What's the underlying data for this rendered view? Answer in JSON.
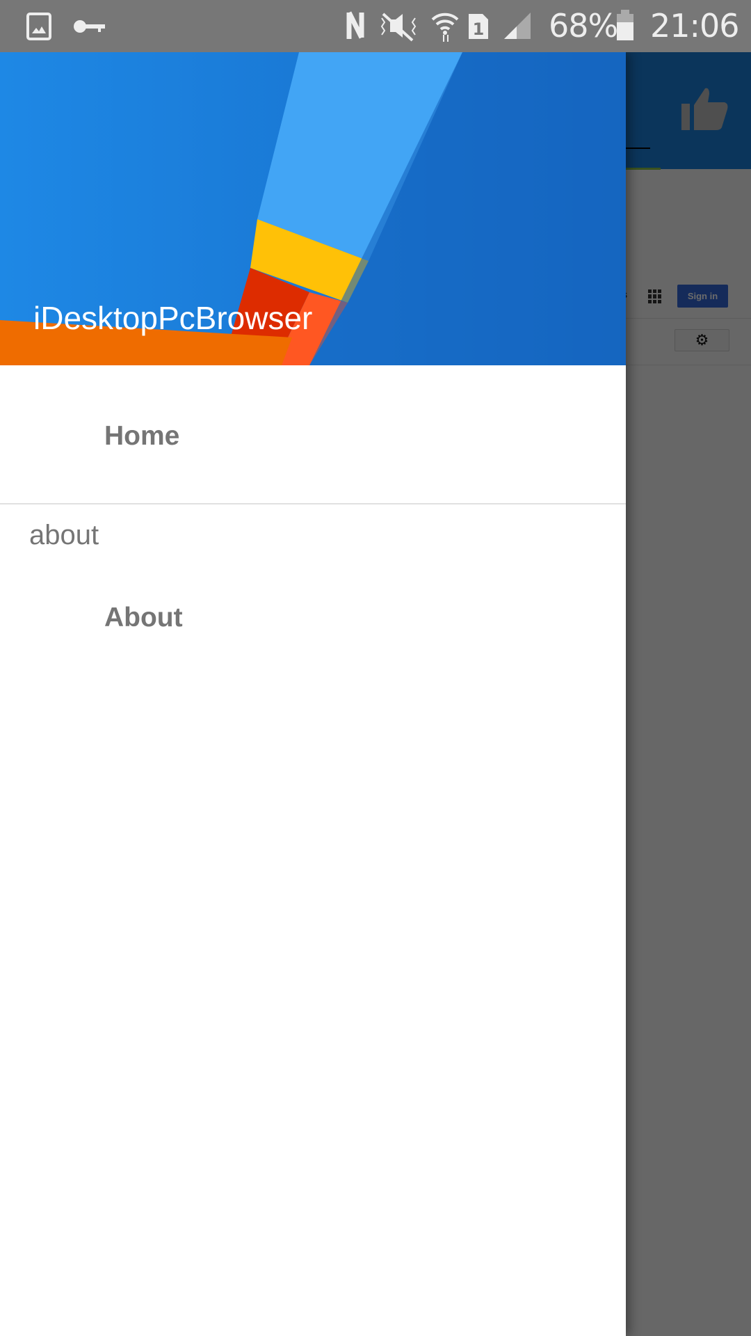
{
  "status_bar": {
    "battery": "68%",
    "time": "21:06",
    "icons": [
      "gallery-icon",
      "vpn-key-icon",
      "nfc-icon",
      "vibrate-mute-icon",
      "wifi-icon",
      "sim-1-icon",
      "signal-icon",
      "battery-icon"
    ]
  },
  "background_page": {
    "partial_text": "s",
    "sign_in_label": "Sign in",
    "accent": "#1a7fd8",
    "button_color": "#3367d6"
  },
  "drawer": {
    "app_title": "iDesktopPcBrowser",
    "items": [
      {
        "label": "Home"
      }
    ],
    "sections": [
      {
        "header": "about",
        "items": [
          {
            "label": "About"
          }
        ]
      }
    ]
  }
}
